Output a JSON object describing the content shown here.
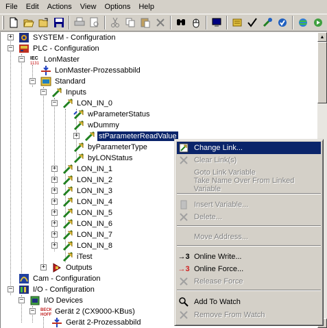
{
  "menu": [
    "File",
    "Edit",
    "Actions",
    "View",
    "Options",
    "Help"
  ],
  "toolbar_icons": [
    "new-icon",
    "open-icon",
    "open-folder-icon",
    "save-icon",
    "print-icon",
    "print-preview-icon",
    "cut-icon",
    "copy-icon",
    "paste-icon",
    "delete-icon",
    "find-icon",
    "mouse-icon",
    "monitor-icon",
    "target-icon",
    "check-icon",
    "config-icon",
    "activate-icon",
    "network-icon",
    "run-icon"
  ],
  "tree": {
    "system": "SYSTEM - Configuration",
    "plc": "PLC - Configuration",
    "lonmaster": "LonMaster",
    "lonmaster_image": "LonMaster-Prozessabbild",
    "standard": "Standard",
    "inputs": "Inputs",
    "lon_in_0": "LON_IN_0",
    "wparamstatus": "wParameterStatus",
    "wdummy": "wDummy",
    "stparam": "stParameterReadValue",
    "byparamtype": "byParameterType",
    "bylonstatus": "byLONStatus",
    "lon_in": [
      "LON_IN_1",
      "LON_IN_2",
      "LON_IN_3",
      "LON_IN_4",
      "LON_IN_5",
      "LON_IN_6",
      "LON_IN_7",
      "LON_IN_8"
    ],
    "itest": "iTest",
    "outputs": "Outputs",
    "cam": "Cam - Configuration",
    "io": "I/O - Configuration",
    "io_devices": "I/O Devices",
    "geraet2": "Gerät 2 (CX9000-KBus)",
    "geraet2_image": "Gerät 2-Prozessabbild",
    "beckhoff_logo": "BECK HOFF"
  },
  "context_menu": {
    "change_link": "Change Link...",
    "clear_links": "Clear Link(s)",
    "goto_link": "Goto Link Variable",
    "take_name": "Take Name Over From Linked Variable",
    "insert_var": "Insert Variable...",
    "delete": "Delete...",
    "move_address": "Move Address...",
    "online_write": "Online Write...",
    "online_force": "Online Force...",
    "release_force": "Release Force",
    "add_watch": "Add To Watch",
    "remove_watch": "Remove From Watch",
    "online_glyph": "→3"
  }
}
